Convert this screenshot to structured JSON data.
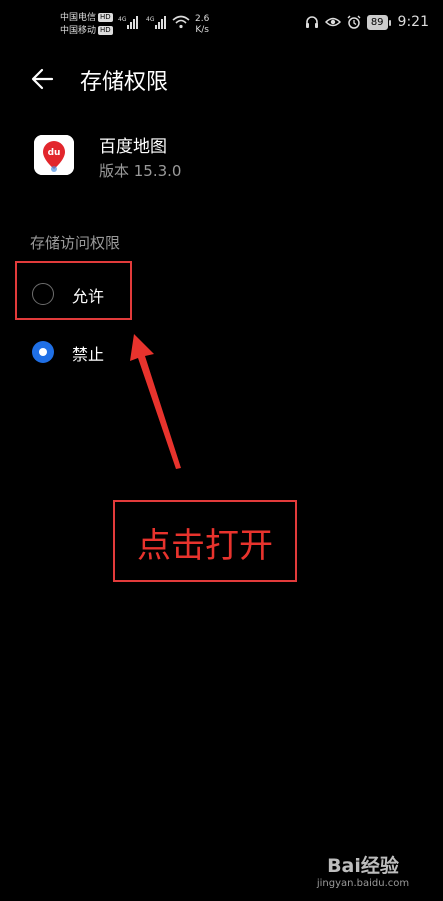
{
  "status_bar": {
    "carrier1": "中国电信",
    "carrier2": "中国移动",
    "hd_badge": "HD",
    "net_4g": "4G",
    "speed_value": "2.6",
    "speed_unit": "K/s",
    "battery": "89",
    "time": "9:21"
  },
  "header": {
    "title": "存储权限"
  },
  "app": {
    "name": "百度地图",
    "version": "版本 15.3.0",
    "icon_text": "du"
  },
  "section": {
    "label": "存储访问权限"
  },
  "options": [
    {
      "label": "允许",
      "selected": false
    },
    {
      "label": "禁止",
      "selected": true
    }
  ],
  "annotation": {
    "text": "点击打开",
    "color": "#e8332d"
  },
  "watermark": {
    "logo": "Bai经验",
    "url": "jingyan.baidu.com"
  }
}
